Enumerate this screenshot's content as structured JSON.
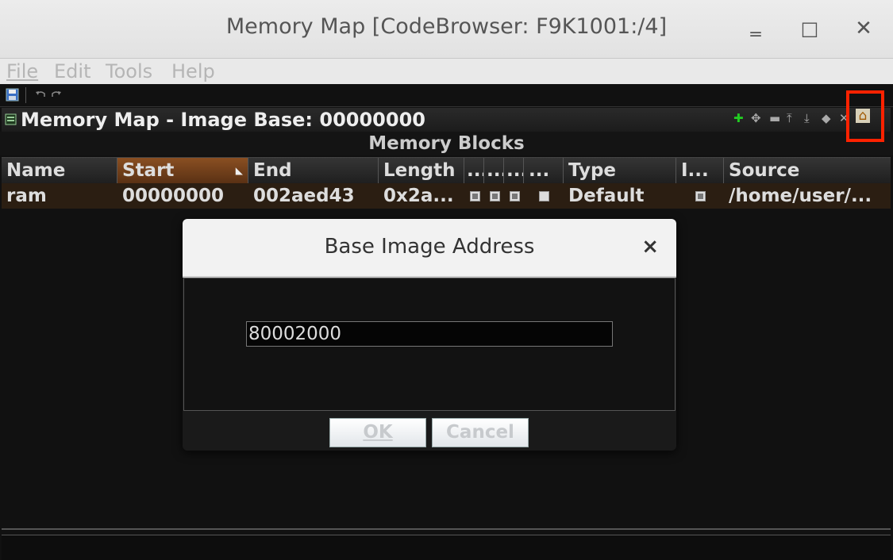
{
  "window": {
    "title": "Memory Map [CodeBrowser: F9K1001:/4]",
    "minimize_glyph": "‗",
    "maximize_glyph": "□",
    "close_glyph": "✕"
  },
  "menubar": {
    "items": [
      "File",
      "Edit",
      "Tools",
      "Help"
    ]
  },
  "panel": {
    "title": "Memory Map - Image Base: 00000000",
    "section_label": "Memory Blocks",
    "icons": {
      "add": "✚",
      "move": "✥",
      "remove": "▬",
      "move_up": "⤒",
      "move_down": "⤓",
      "merge": "◆",
      "split": "✕",
      "image_base": "⌂"
    }
  },
  "table": {
    "columns": [
      "Name",
      "Start",
      "End",
      "Length",
      "...",
      "...",
      "...",
      "...",
      "Type",
      "I...",
      "Source"
    ],
    "rows": [
      {
        "name": "ram",
        "start": "00000000",
        "end": "002aed43",
        "length": "0x2a...",
        "type": "Default",
        "source": "/home/user/..."
      }
    ]
  },
  "dialog": {
    "title": "Base Image Address",
    "close_glyph": "×",
    "input_value": "80002000",
    "ok_label": "OK",
    "cancel_label": "Cancel"
  }
}
